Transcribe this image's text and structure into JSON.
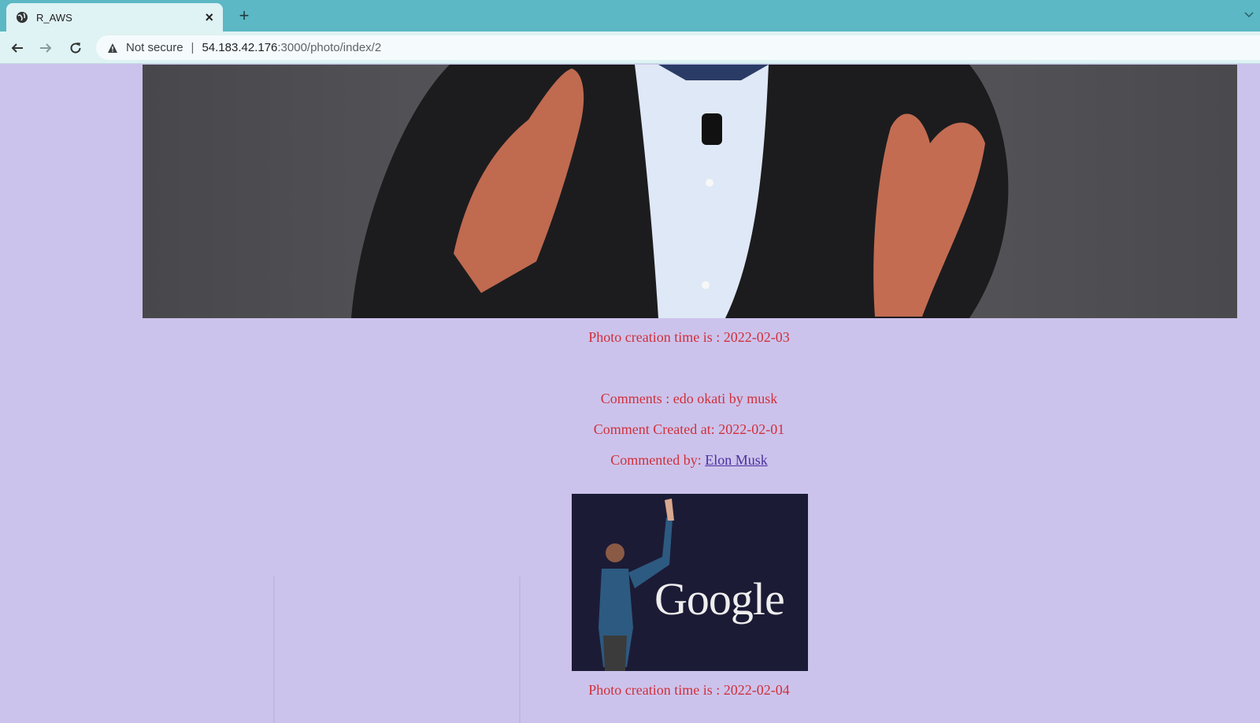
{
  "browser": {
    "tab_title": "R_AWS",
    "new_tab_label": "+",
    "close_label": "×",
    "security_label": "Not secure",
    "separator": "|",
    "url_host": "54.183.42.176",
    "url_rest": ":3000/photo/index/2"
  },
  "page": {
    "photo1": {
      "creation_label": "Photo creation time is : 2022-02-03"
    },
    "comment": {
      "text": "Comments : edo okati by musk",
      "created": "Comment Created at: 2022-02-01",
      "by_label": "Commented by: ",
      "by_name": "Elon Musk"
    },
    "photo2": {
      "logo_text": "Google",
      "creation_label": "Photo creation time is : 2022-02-04"
    }
  },
  "colors": {
    "page_bg": "#ccc3ec",
    "caption_text": "#d0303a",
    "link": "#4a2fa0",
    "tabbar": "#5bb8c4"
  },
  "icons": [
    "globe-icon",
    "close-icon",
    "plus-icon",
    "chevron-down-icon",
    "back-arrow-icon",
    "forward-arrow-icon",
    "reload-icon",
    "warning-icon"
  ]
}
